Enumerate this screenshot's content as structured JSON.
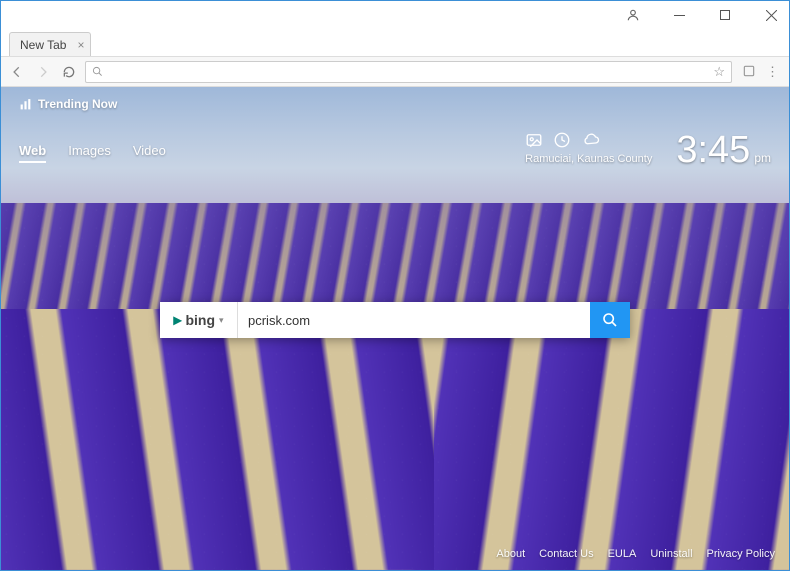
{
  "chrome": {
    "tab_title": "New Tab",
    "addr_placeholder": ""
  },
  "trending": {
    "label": "Trending Now"
  },
  "nav": {
    "web": "Web",
    "images": "Images",
    "video": "Video"
  },
  "weather": {
    "location": "Ramuciai, Kaunas County"
  },
  "clock": {
    "time": "3:45",
    "ampm": "pm"
  },
  "search": {
    "engine_label": "bing",
    "value": "pcrisk.com"
  },
  "footer": {
    "about": "About",
    "contact": "Contact Us",
    "eula": "EULA",
    "uninstall": "Uninstall",
    "privacy": "Privacy Policy"
  }
}
